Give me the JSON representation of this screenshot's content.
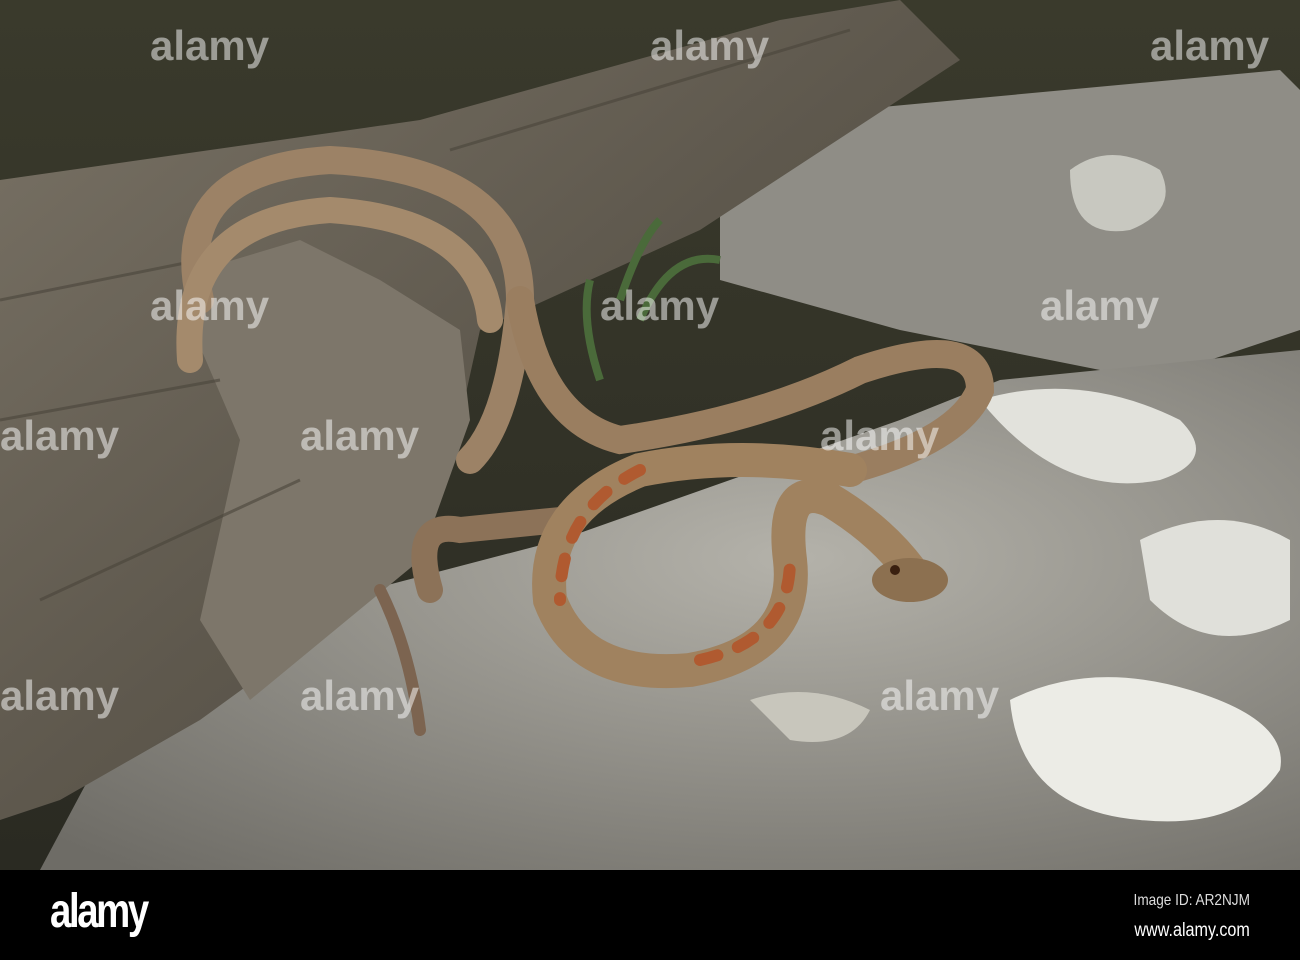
{
  "image": {
    "subject": "snake-on-log-and-rock",
    "watermark_text": "alamy"
  },
  "footer": {
    "logo": "alamy",
    "image_id": "Image ID: AR2NJM",
    "website": "www.alamy.com"
  },
  "colors": {
    "background": "#000000",
    "rock": "#9a9890",
    "lichen": "#e6e6e0",
    "log": "#6b6458",
    "snake": "#a08466",
    "snake_blotch": "#b05a30"
  }
}
